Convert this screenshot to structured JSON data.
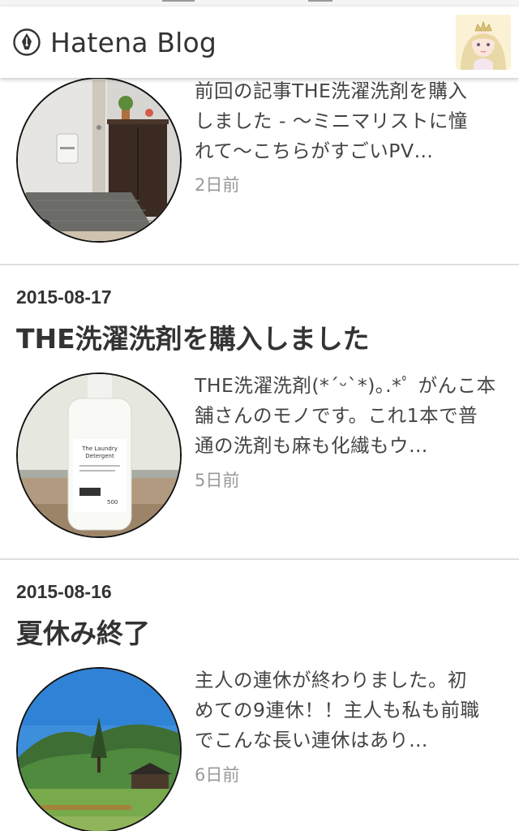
{
  "header": {
    "logo_text": "Hatena Blog",
    "logo_icon": "hatena-pen-icon",
    "avatar_icon": "user-avatar-princess"
  },
  "entries": [
    {
      "date": "",
      "title": "",
      "summary_lines": [
        "前回の記事THE洗濯洗剤を購入",
        "しました - 〜ミニマリストに憧",
        "れて〜こちらがすごいPV…"
      ],
      "ago": "2日前"
    },
    {
      "date": "2015-08-17",
      "title": "THE洗濯洗剤を購入しました",
      "summary_lines": [
        "THE洗濯洗剤(*ˊᵕˋ*)｡.*ﾟ がんこ本",
        "舗さんのモノです。これ1本で普",
        "通の洗剤も麻も化繊もウ…"
      ],
      "ago": "5日前",
      "thumb_bottle_label": "The Laundry Detergent"
    },
    {
      "date": "2015-08-16",
      "title": "夏休み終了",
      "summary_lines": [
        "主人の連休が終わりました。初",
        "めての9連休！！主人も私も前職",
        "でこんな長い連休はあり…"
      ],
      "ago": "6日前"
    }
  ],
  "colors": {
    "text": "#333333",
    "muted": "#999999",
    "divider": "#e0e0e0",
    "header_bg": "#ffffff"
  }
}
